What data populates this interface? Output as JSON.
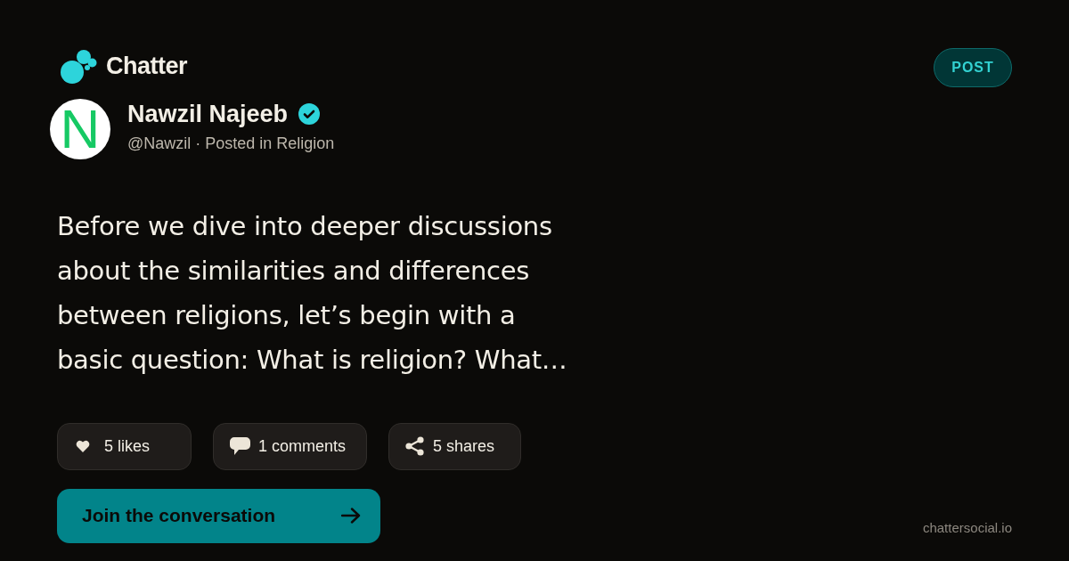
{
  "brand": {
    "name": "Chatter"
  },
  "post_badge": {
    "label": "POST"
  },
  "author": {
    "avatar_letter": "N",
    "name": "Nawzil Najeeb",
    "verified": true,
    "meta": "@Nawzil · Posted in Religion"
  },
  "body": "Before we dive into deeper discussions about the similarities and differences between religions, let’s begin with a basic question: What is religion? What…",
  "stats": [
    {
      "kind": "likes",
      "label": "5 likes"
    },
    {
      "kind": "comments",
      "label": "1 comments"
    },
    {
      "kind": "shares",
      "label": "5 shares"
    }
  ],
  "cta": {
    "label": "Join the conversation"
  },
  "footer": {
    "domain": "chattersocial.io"
  }
}
